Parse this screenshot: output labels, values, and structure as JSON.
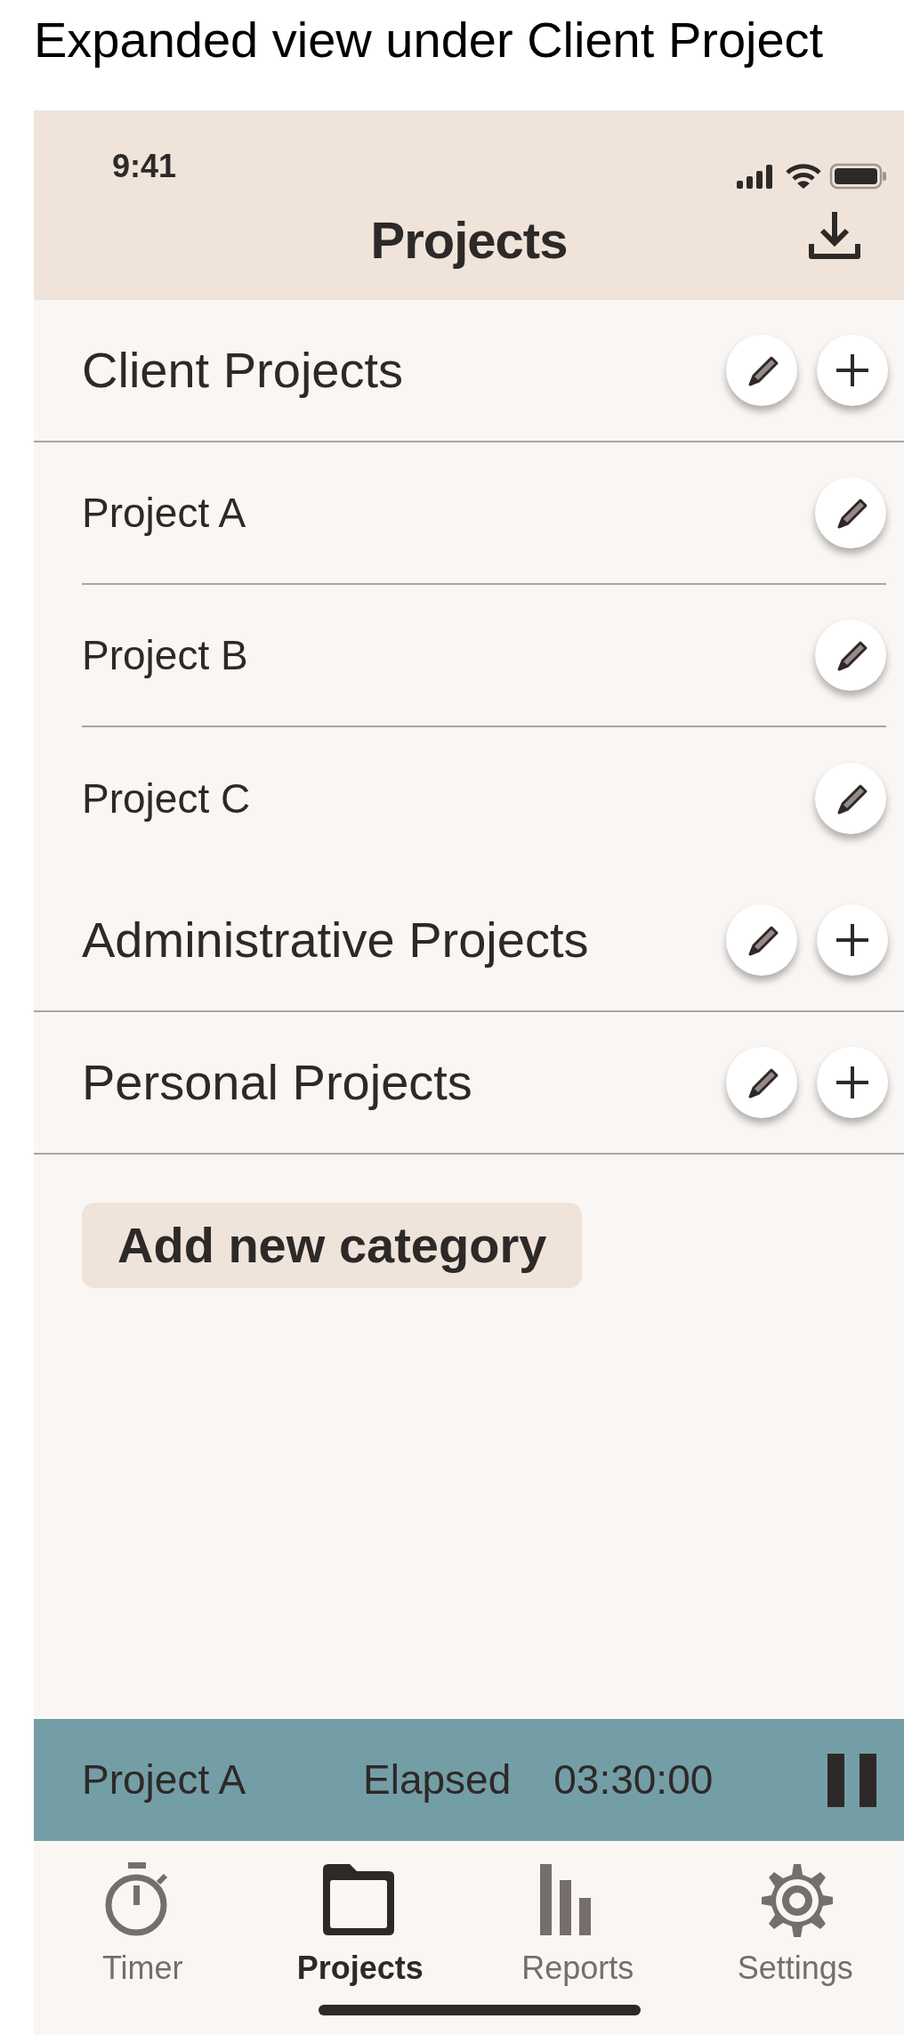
{
  "caption": "Expanded view under Client Project",
  "status_bar": {
    "time": "9:41"
  },
  "header": {
    "title": "Projects"
  },
  "categories": [
    {
      "name": "Client Projects",
      "projects": [
        {
          "name": "Project A"
        },
        {
          "name": "Project B"
        },
        {
          "name": "Project C"
        }
      ]
    },
    {
      "name": "Administrative Projects"
    },
    {
      "name": "Personal Projects"
    }
  ],
  "add_category_button": "Add new category",
  "timer_bar": {
    "project": "Project A",
    "label": "Elapsed",
    "elapsed": "03:30:00"
  },
  "tabs": [
    {
      "label": "Timer",
      "selected": false,
      "kind": "stopwatch"
    },
    {
      "label": "Projects",
      "selected": true,
      "kind": "folder"
    },
    {
      "label": "Reports",
      "selected": false,
      "kind": "chart"
    },
    {
      "label": "Settings",
      "selected": false,
      "kind": "gear"
    }
  ]
}
